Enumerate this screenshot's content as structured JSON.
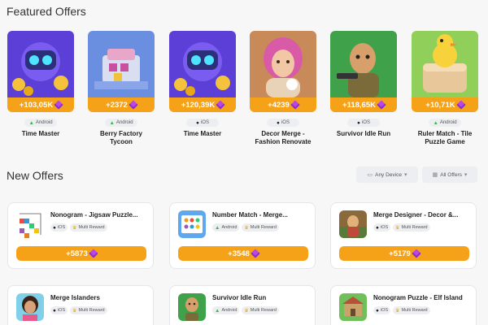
{
  "featured": {
    "title": "Featured Offers",
    "items": [
      {
        "reward": "+103,05K",
        "platform": "Android",
        "name": "Time Master"
      },
      {
        "reward": "+2372",
        "platform": "Android",
        "name": "Berry Factory Tycoon"
      },
      {
        "reward": "+120,39K",
        "platform": "iOS",
        "name": "Time Master"
      },
      {
        "reward": "+4239",
        "platform": "iOS",
        "name": "Decor Merge - Fashion Renovate"
      },
      {
        "reward": "+118,65K",
        "platform": "iOS",
        "name": "Survivor Idle Run"
      },
      {
        "reward": "+10,71K",
        "platform": "Android",
        "name": "Ruler Match - Tile Puzzle Game"
      }
    ]
  },
  "new_offers": {
    "title": "New Offers",
    "filters": {
      "device": "Any Device",
      "offers": "All Offers"
    },
    "items": [
      {
        "title": "Nonogram - Jigsaw Puzzle...",
        "platform": "iOS",
        "tag": "Multi Reward",
        "reward": "+5873"
      },
      {
        "title": "Number Match - Merge...",
        "platform": "Android",
        "tag": "Multi Reward",
        "reward": "+3548"
      },
      {
        "title": "Merge Designer - Decor &...",
        "platform": "iOS",
        "tag": "Multi Reward",
        "reward": "+5179"
      },
      {
        "title": "Merge Islanders",
        "platform": "iOS",
        "tag": "Multi Reward",
        "reward": ""
      },
      {
        "title": "Survivor Idle Run",
        "platform": "Android",
        "tag": "Multi Reward",
        "reward": ""
      },
      {
        "title": "Nonogram Puzzle - Elf Island",
        "platform": "iOS",
        "tag": "Multi Reward",
        "reward": ""
      }
    ]
  },
  "colors": {
    "accent": "#f5a218",
    "gem": "#b847e6",
    "android": "#3dba4e"
  },
  "icons": [
    "android-icon",
    "apple-icon",
    "gem-icon",
    "trophy-icon",
    "chevron-down-icon",
    "filter-icon",
    "device-icon"
  ]
}
